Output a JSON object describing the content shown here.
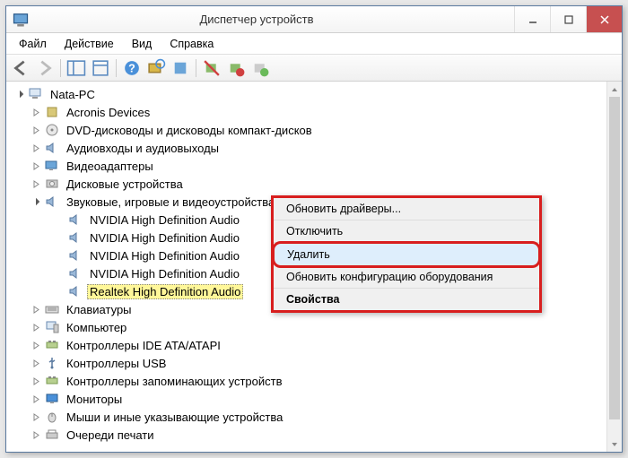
{
  "window": {
    "title": "Диспетчер устройств"
  },
  "menu": {
    "file": "Файл",
    "action": "Действие",
    "view": "Вид",
    "help": "Справка"
  },
  "tree": {
    "root": "Nata-PC",
    "items": [
      {
        "label": "Acronis Devices",
        "expanded": false
      },
      {
        "label": "DVD-дисководы и дисководы компакт-дисков",
        "expanded": false
      },
      {
        "label": "Аудиовходы и аудиовыходы",
        "expanded": false
      },
      {
        "label": "Видеоадаптеры",
        "expanded": false
      },
      {
        "label": "Дисковые устройства",
        "expanded": false
      },
      {
        "label": "Звуковые, игровые и видеоустройства",
        "expanded": true,
        "children": [
          {
            "label": "NVIDIA High Definition Audio"
          },
          {
            "label": "NVIDIA High Definition Audio"
          },
          {
            "label": "NVIDIA High Definition Audio"
          },
          {
            "label": "NVIDIA High Definition Audio"
          },
          {
            "label": "Realtek High Definition Audio",
            "selected": true
          }
        ]
      },
      {
        "label": "Клавиатуры",
        "expanded": false
      },
      {
        "label": "Компьютер",
        "expanded": false
      },
      {
        "label": "Контроллеры IDE ATA/ATAPI",
        "expanded": false
      },
      {
        "label": "Контроллеры USB",
        "expanded": false
      },
      {
        "label": "Контроллеры запоминающих устройств",
        "expanded": false
      },
      {
        "label": "Мониторы",
        "expanded": false
      },
      {
        "label": "Мыши и иные указывающие устройства",
        "expanded": false
      },
      {
        "label": "Очереди печати",
        "expanded": false
      }
    ]
  },
  "context_menu": {
    "update_drivers": "Обновить драйверы...",
    "disable": "Отключить",
    "delete": "Удалить",
    "scan_hardware": "Обновить конфигурацию оборудования",
    "properties": "Свойства"
  },
  "icons": {
    "computer": "computer",
    "acronis": "generic",
    "dvd": "dvd",
    "audio": "speaker",
    "video": "display",
    "disk": "disk",
    "sound": "speaker",
    "audiodev": "speaker",
    "keyboard": "keyboard",
    "pc": "desktop",
    "ide": "controller",
    "usb": "usb",
    "storage": "controller",
    "monitor": "monitor",
    "mouse": "mouse",
    "printer": "printer"
  }
}
